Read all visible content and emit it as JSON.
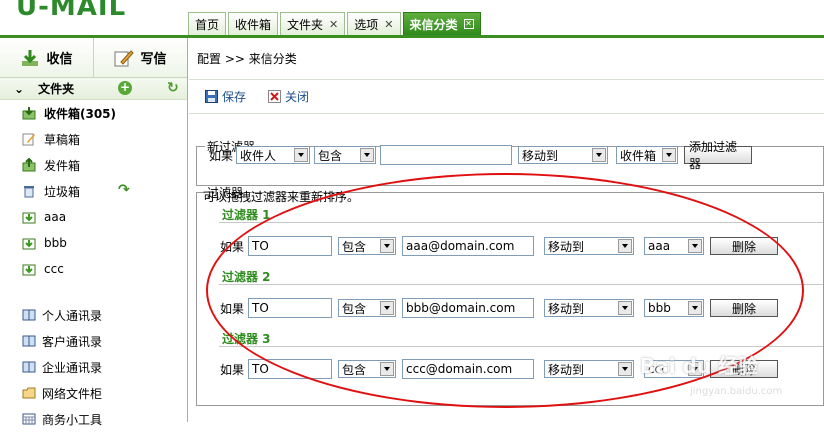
{
  "app": {
    "logo": "U-MAIL"
  },
  "tabs": [
    {
      "label": "首页",
      "closable": false
    },
    {
      "label": "收件箱",
      "closable": false
    },
    {
      "label": "文件夹",
      "closable": true
    },
    {
      "label": "选项",
      "closable": true
    },
    {
      "label": "来信分类",
      "closable": true,
      "active": true
    }
  ],
  "sidebar": {
    "receive_label": "收信",
    "compose_label": "写信",
    "folders_title": "文件夹",
    "folders": [
      {
        "label": "收件箱(305)",
        "icon": "inbox-icon",
        "bold": true
      },
      {
        "label": "草稿箱",
        "icon": "draft-icon"
      },
      {
        "label": "发件箱",
        "icon": "outbox-icon"
      },
      {
        "label": "垃圾箱",
        "icon": "trash-icon"
      },
      {
        "label": "aaa",
        "icon": "folder-icon"
      },
      {
        "label": "bbb",
        "icon": "folder-icon"
      },
      {
        "label": "ccc",
        "icon": "folder-icon"
      }
    ],
    "contacts": [
      {
        "label": "个人通讯录",
        "icon": "addressbook-icon"
      },
      {
        "label": "客户通讯录",
        "icon": "addressbook-icon"
      },
      {
        "label": "企业通讯录",
        "icon": "addressbook-icon"
      },
      {
        "label": "网络文件柜",
        "icon": "cabinet-icon"
      },
      {
        "label": "商务小工具",
        "icon": "calendar-icon"
      }
    ]
  },
  "main": {
    "breadcrumb": "配置 >> 来信分类",
    "toolbar": {
      "save_label": "保存",
      "close_label": "关闭"
    },
    "new_filter": {
      "legend": "新过滤器",
      "if_label": "如果",
      "field": "收件人",
      "op": "包含",
      "value": "",
      "action": "移动到",
      "target": "收件箱",
      "add_button": "添加过滤器"
    },
    "filters_section": {
      "legend": "过滤器",
      "hint": "可以拖拽过滤器来重新排序。",
      "if_label": "如果",
      "delete_label": "删除",
      "filters": [
        {
          "title": "过滤器 1",
          "field": "TO",
          "op": "包含",
          "value": "aaa@domain.com",
          "action": "移动到",
          "target": "aaa"
        },
        {
          "title": "过滤器 2",
          "field": "TO",
          "op": "包含",
          "value": "bbb@domain.com",
          "action": "移动到",
          "target": "bbb"
        },
        {
          "title": "过滤器 3",
          "field": "TO",
          "op": "包含",
          "value": "ccc@domain.com",
          "action": "移动到",
          "target": "ccc"
        }
      ]
    }
  },
  "watermark": {
    "text": "Bai du 经验",
    "url": "jingyan.baidu.com"
  },
  "colors": {
    "brand_green": "#3a8e22",
    "link_blue": "#1d4f8c",
    "annotation_red": "#e01010"
  }
}
